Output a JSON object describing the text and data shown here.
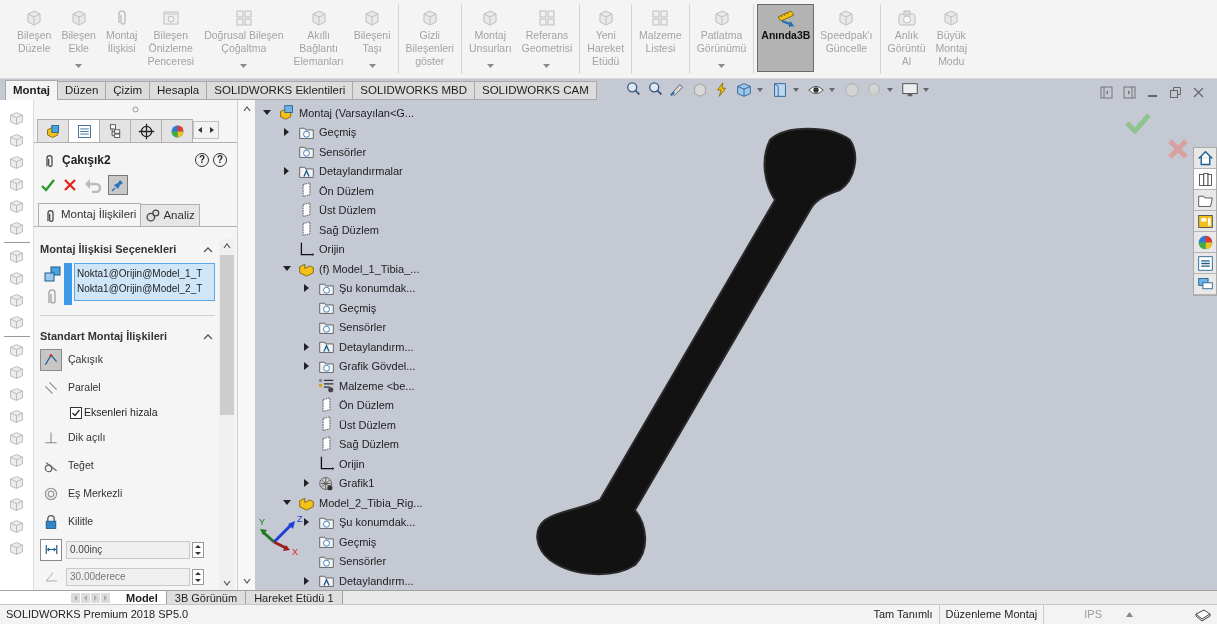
{
  "ribbon": {
    "groups": [
      {
        "items": [
          {
            "label": "Bileşen\nDüzele",
            "dropdown": false,
            "disabled": true,
            "selected": false
          },
          {
            "label": "Bileşen\nEkle",
            "dropdown": true,
            "disabled": true,
            "selected": false
          },
          {
            "label": "Montaj\nİlişkisi",
            "dropdown": false,
            "disabled": true,
            "selected": false
          },
          {
            "label": "Bileşen\nÖnizleme\nPenceresi",
            "dropdown": false,
            "disabled": true,
            "selected": false
          },
          {
            "label": "Doğrusal Bileşen\nÇoğaltma",
            "dropdown": true,
            "disabled": true,
            "selected": false
          },
          {
            "label": "Akıllı\nBağlantı\nElemanları",
            "dropdown": false,
            "disabled": true,
            "selected": false
          },
          {
            "label": "Bileşeni\nTaşı",
            "dropdown": true,
            "disabled": true,
            "selected": false
          }
        ]
      },
      {
        "items": [
          {
            "label": "Gizli\nBileşenleri\ngöster",
            "dropdown": false,
            "disabled": true,
            "selected": false
          }
        ]
      },
      {
        "items": [
          {
            "label": "Montaj\nUnsurları",
            "dropdown": true,
            "disabled": true,
            "selected": false
          },
          {
            "label": "Referans\nGeometrisi",
            "dropdown": true,
            "disabled": true,
            "selected": false
          }
        ]
      },
      {
        "items": [
          {
            "label": "Yeni\nHareket\nEtüdü",
            "dropdown": false,
            "disabled": true,
            "selected": false
          }
        ]
      },
      {
        "items": [
          {
            "label": "Malzeme\nListesi",
            "dropdown": false,
            "disabled": true,
            "selected": false
          }
        ]
      },
      {
        "items": [
          {
            "label": "Patlatma\nGörünümü",
            "dropdown": true,
            "disabled": true,
            "selected": false
          }
        ]
      },
      {
        "items": [
          {
            "label": "Anında3B",
            "dropdown": false,
            "disabled": false,
            "selected": true
          },
          {
            "label": "Speedpak'ı\nGüncelle",
            "dropdown": false,
            "disabled": true,
            "selected": false
          }
        ]
      },
      {
        "items": [
          {
            "label": "Anlık\nGörüntü\nAl",
            "dropdown": false,
            "disabled": true,
            "selected": false
          },
          {
            "label": "Büyük\nMontaj\nModu",
            "dropdown": false,
            "disabled": true,
            "selected": false
          }
        ]
      }
    ]
  },
  "tabs": [
    {
      "label": "Montaj",
      "selected": true
    },
    {
      "label": "Düzen",
      "selected": false
    },
    {
      "label": "Çizim",
      "selected": false
    },
    {
      "label": "Hesapla",
      "selected": false
    },
    {
      "label": "SOLIDWORKS Eklentileri",
      "selected": false
    },
    {
      "label": "SOLIDWORKS MBD",
      "selected": false
    },
    {
      "label": "SOLIDWORKS CAM",
      "selected": false
    }
  ],
  "property_manager": {
    "tabs": [
      {
        "selected": false
      },
      {
        "selected": true
      },
      {
        "selected": false
      },
      {
        "selected": false
      },
      {
        "selected": false
      }
    ],
    "title": "Çakışık2",
    "help_buttons": [
      "?",
      "?"
    ],
    "pin_pressed": true,
    "subtabs": [
      {
        "label": "Montaj İlişkileri",
        "selected": true
      },
      {
        "label": "Analiz",
        "selected": false
      }
    ],
    "selections": {
      "title": "Montaj İlişkisi Seçenekleri",
      "expanded": true,
      "entries": [
        "Nokta1@Orijin@Model_1_T",
        "Nokta1@Orijin@Model_2_T"
      ]
    },
    "standard_mates": {
      "title": "Standart Montaj İlişkileri",
      "expanded": true,
      "items": [
        {
          "kind": "mate",
          "label": "Çakışık",
          "selected": true
        },
        {
          "kind": "mate",
          "label": "Paralel",
          "selected": false
        },
        {
          "kind": "checkbox",
          "label": "Eksenleri hizala",
          "checked": true
        },
        {
          "kind": "mate",
          "label": "Dik açılı",
          "selected": false
        },
        {
          "kind": "mate",
          "label": "Teğet",
          "selected": false
        },
        {
          "kind": "mate",
          "label": "Eş Merkezli",
          "selected": false
        },
        {
          "kind": "mate",
          "label": "Kilitle",
          "selected": false
        },
        {
          "kind": "spin",
          "value": "0.00inç",
          "disabled": false
        },
        {
          "kind": "spin",
          "value": "30.00derece",
          "disabled": true
        }
      ]
    }
  },
  "tree": [
    {
      "label": "Montaj  (Varsayılan<G...",
      "kind": "assembly",
      "expanded": true,
      "children": [
        {
          "label": "Geçmiş",
          "kind": "folder",
          "expanded": false
        },
        {
          "label": "Sensörler",
          "kind": "folder"
        },
        {
          "label": "Detaylandırmalar",
          "kind": "annotation",
          "expanded": false
        },
        {
          "label": "Ön Düzlem",
          "kind": "plane"
        },
        {
          "label": "Üst Düzlem",
          "kind": "plane"
        },
        {
          "label": "Sağ Düzlem",
          "kind": "plane"
        },
        {
          "label": "Orijin",
          "kind": "origin"
        },
        {
          "label": "(f) Model_1_Tibia_...",
          "kind": "part",
          "expanded": true,
          "children": [
            {
              "label": "Şu konumdak...",
              "kind": "folder",
              "expanded": false
            },
            {
              "label": "Geçmiş",
              "kind": "folder"
            },
            {
              "label": "Sensörler",
              "kind": "folder"
            },
            {
              "label": "Detaylandırm...",
              "kind": "annotation",
              "expanded": false
            },
            {
              "label": "Grafik Gövdel...",
              "kind": "folder",
              "expanded": false
            },
            {
              "label": "Malzeme <be...",
              "kind": "material"
            },
            {
              "label": "Ön Düzlem",
              "kind": "plane"
            },
            {
              "label": "Üst Düzlem",
              "kind": "plane"
            },
            {
              "label": "Sağ Düzlem",
              "kind": "plane"
            },
            {
              "label": "Orijin",
              "kind": "origin"
            },
            {
              "label": "Grafik1",
              "kind": "mesh",
              "expanded": false
            }
          ]
        },
        {
          "label": "Model_2_Tibia_Rig...",
          "kind": "part",
          "expanded": true,
          "children": [
            {
              "label": "Şu konumdak...",
              "kind": "folder",
              "expanded": false
            },
            {
              "label": "Geçmiş",
              "kind": "folder"
            },
            {
              "label": "Sensörler",
              "kind": "folder"
            },
            {
              "label": "Detaylandırm...",
              "kind": "annotation",
              "expanded": false
            }
          ]
        }
      ]
    }
  ],
  "triad": {
    "x": "X",
    "y": "Y",
    "z": "Z"
  },
  "sheet_tabs": [
    {
      "label": "Model",
      "selected": true
    },
    {
      "label": "3B Görünüm",
      "selected": false
    },
    {
      "label": "Hareket Etüdü 1",
      "selected": false
    }
  ],
  "status_bar": {
    "product": "SOLIDWORKS Premium 2018 SP5.0",
    "fields": [
      "Tam Tanımlı",
      "Düzenleme Montaj"
    ],
    "units": "IPS"
  }
}
